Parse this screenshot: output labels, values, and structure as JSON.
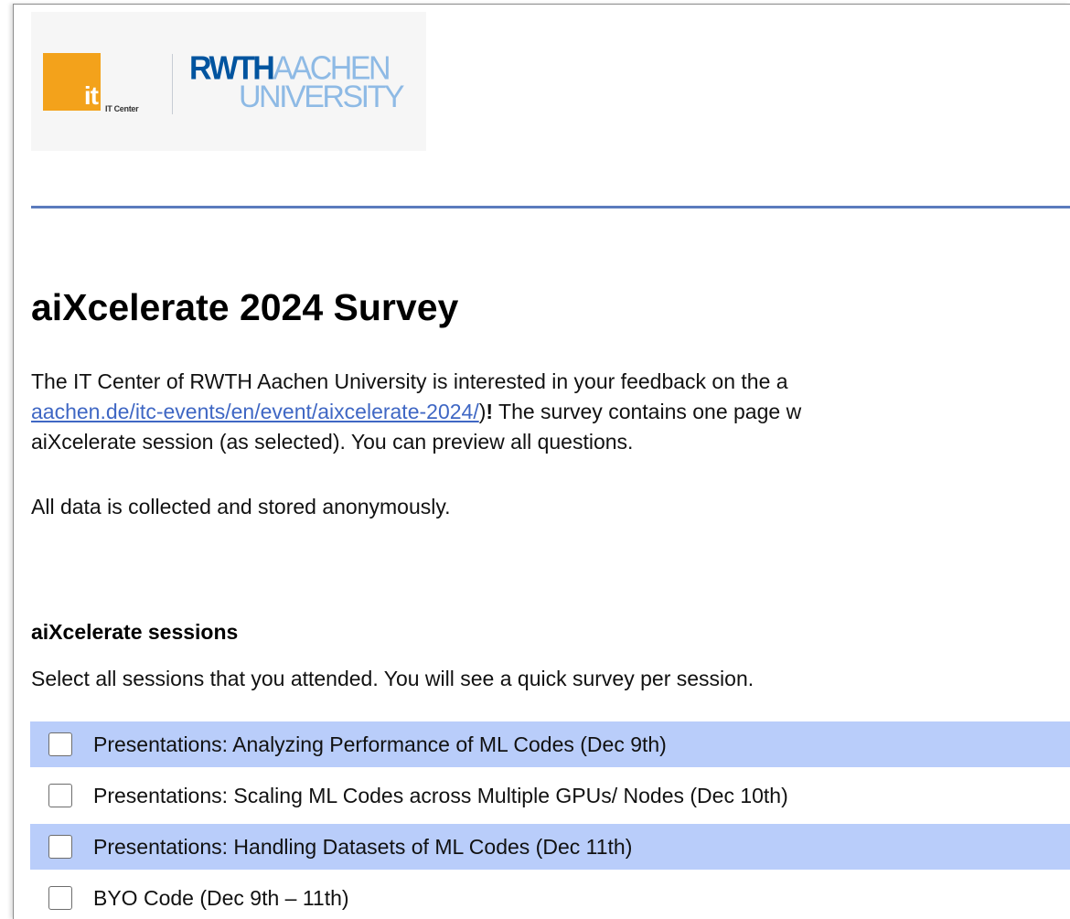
{
  "header": {
    "logo_it_text": "it",
    "logo_it_center_label": "IT Center",
    "logo_rwth_bold": "RWTH",
    "logo_rwth_light": "AACHEN",
    "logo_university": "UNIVERSITY",
    "brand_colors": {
      "it_orange": "#f3a21b",
      "rwth_blue": "#00549f",
      "rwth_light_blue": "#8ebae5",
      "rule_blue": "#5b7bbd"
    }
  },
  "survey": {
    "title": "aiXcelerate 2024 Survey",
    "intro_line1": "The IT Center of RWTH Aachen University is interested in your feedback on the a",
    "intro_link": "aachen.de/itc-events/en/event/aixcelerate-2024/",
    "intro_after_link_paren": ")",
    "intro_after_link_bang": "!",
    "intro_after_link_rest": " The survey contains one page w",
    "intro_line3": "aiXcelerate session (as selected). You can preview all questions.",
    "anonymity_note": "All data is collected and stored anonymously."
  },
  "sessions": {
    "title": "aiXcelerate sessions",
    "description": "Select all sessions that you attended. You will see a quick survey per session.",
    "highlight_color": "#b9cdfa",
    "options": [
      {
        "label": "Presentations: Analyzing Performance of ML Codes (Dec 9th)",
        "checked": false
      },
      {
        "label": "Presentations: Scaling ML Codes across Multiple GPUs/ Nodes (Dec 10th)",
        "checked": false
      },
      {
        "label": "Presentations: Handling Datasets of ML Codes (Dec 11th)",
        "checked": false
      },
      {
        "label": "BYO Code (Dec 9th – 11th)",
        "checked": false
      }
    ]
  }
}
